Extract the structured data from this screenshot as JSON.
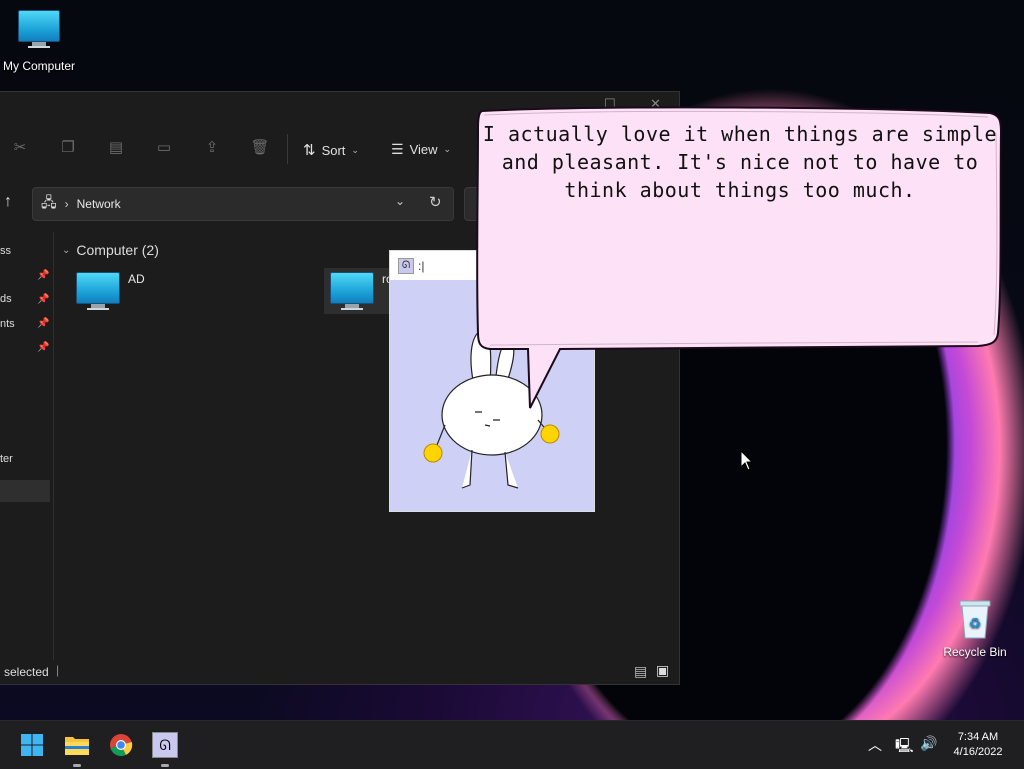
{
  "desktop": {
    "my_computer_label": "My Computer",
    "recycle_bin_label": "Recycle Bin"
  },
  "explorer": {
    "toolbar": {
      "sort_label": "Sort",
      "view_label": "View"
    },
    "address": {
      "location": "Network"
    },
    "nav": {
      "items": [
        "ss",
        "ds",
        "nts",
        "ter"
      ]
    },
    "section": {
      "title": "Computer (2)"
    },
    "files": [
      {
        "name": "AD"
      },
      {
        "name": "ro"
      }
    ],
    "status": {
      "text": "selected"
    }
  },
  "mascot": {
    "title": ":|"
  },
  "bubble": {
    "lines": [
      "I actually love it when things are simple",
      "and pleasant. It's nice not to have to",
      "think about things too much."
    ]
  },
  "taskbar": {
    "time": "7:34 AM",
    "date": "4/16/2022"
  },
  "colors": {
    "bubble_fill": "#fde2f7",
    "bubble_outline": "#1a0a1a",
    "mascot_bg": "#cfd0f5",
    "accent": "#0f7fbf"
  }
}
